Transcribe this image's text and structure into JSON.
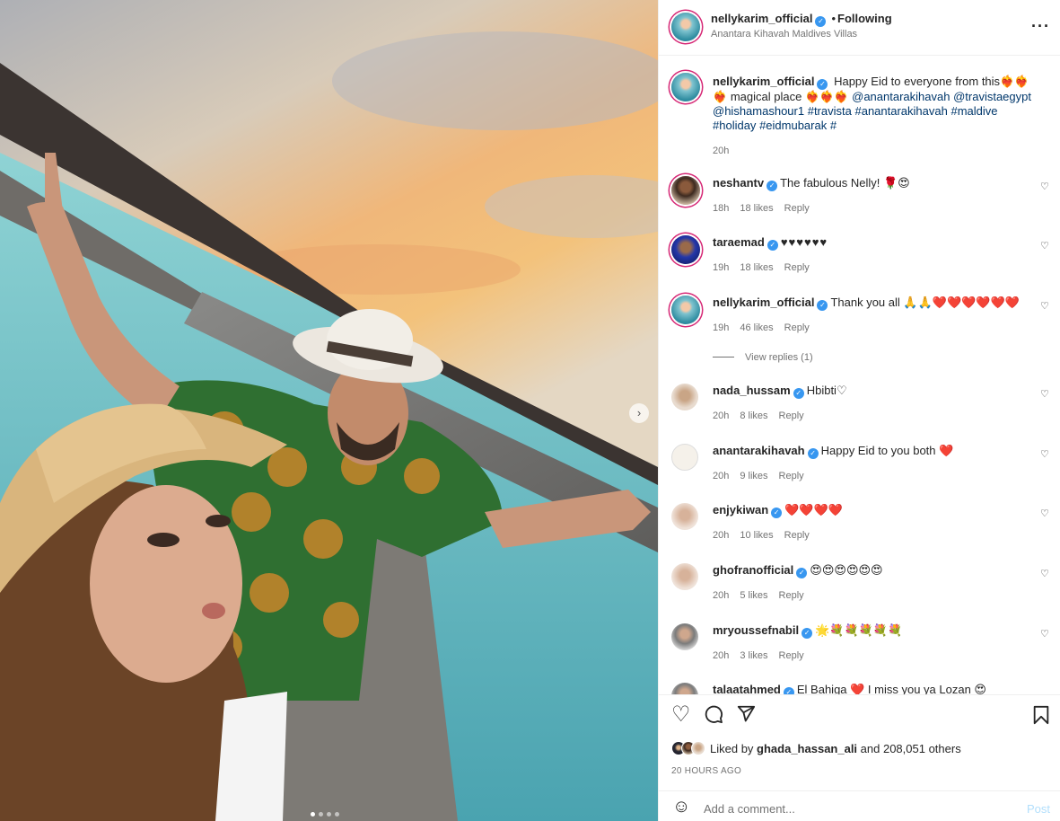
{
  "post": {
    "carousel": {
      "next_icon": "chevron-right-icon",
      "dots_count": 4,
      "active_index": 0
    }
  },
  "header": {
    "username": "nellykarim_official",
    "verified_icon": "verified-badge-icon",
    "bullet": "•",
    "follow_status": "Following",
    "location": "Anantara Kihavah Maldives Villas",
    "more_icon": "more-options-icon",
    "more_glyph": "···"
  },
  "caption": {
    "username": "nellykarim_official",
    "text_1": "Happy Eid to everyone from this",
    "hearts_1": "❤️‍🔥❤️‍🔥❤️‍🔥",
    "text_2": "magical place",
    "hearts_2": "❤️‍🔥❤️‍🔥❤️‍🔥",
    "mentions": [
      "@anantarakihavah",
      "@travistaegypt",
      "@hishamashour1"
    ],
    "hashtags": [
      "#travista",
      "#anantarakihavah",
      "#maldive",
      "#holiday",
      "#eidmubarak",
      "#"
    ],
    "time": "20h"
  },
  "comments": [
    {
      "username": "neshantv",
      "text": "The fabulous Nelly! 🌹😍",
      "time": "18h",
      "likes": "18 likes",
      "reply": "Reply"
    },
    {
      "username": "taraemad",
      "text": "♥♥♥♥♥♥",
      "time": "19h",
      "likes": "18 likes",
      "reply": "Reply"
    },
    {
      "username": "nellykarim_official",
      "text": "Thank you all 🙏🙏❤️❤️❤️❤️❤️❤️",
      "time": "19h",
      "likes": "46 likes",
      "reply": "Reply"
    },
    {
      "username": "nada_hussam",
      "text": "Hbibti♡",
      "time": "20h",
      "likes": "8 likes",
      "reply": "Reply"
    },
    {
      "username": "anantarakihavah",
      "text": "Happy Eid to you both ❤️",
      "time": "20h",
      "likes": "9 likes",
      "reply": "Reply"
    },
    {
      "username": "enjykiwan",
      "text": "❤️❤️❤️❤️",
      "time": "20h",
      "likes": "10 likes",
      "reply": "Reply"
    },
    {
      "username": "ghofranofficial",
      "text": "😍😍😍😍😍😍",
      "time": "20h",
      "likes": "5 likes",
      "reply": "Reply"
    },
    {
      "username": "mryoussefnabil",
      "text": "🌟💐💐💐💐💐",
      "time": "20h",
      "likes": "3 likes",
      "reply": "Reply"
    },
    {
      "username": "talaatahmed",
      "text": "El Bahiga ❤️ I miss you ya Lozan 😍",
      "time": "",
      "likes": "",
      "reply": ""
    }
  ],
  "view_replies": "View replies (1)",
  "actions": {
    "like_icon": "heart-icon",
    "comment_icon": "comment-bubble-icon",
    "share_icon": "paper-plane-icon",
    "save_icon": "bookmark-icon",
    "liked_by_prefix": "Liked by",
    "liked_by_user": "ghada_hassan_ali",
    "liked_by_suffix": "and 208,051 others",
    "timestamp": "20 HOURS AGO"
  },
  "add_comment": {
    "emoji_icon": "smiley-icon",
    "placeholder": "Add a comment...",
    "post_label": "Post"
  },
  "colors": {
    "link_blue": "#00376b",
    "verified_blue": "#3897f0",
    "post_disabled": "#b2dffc",
    "story_ring": "#d62976"
  }
}
